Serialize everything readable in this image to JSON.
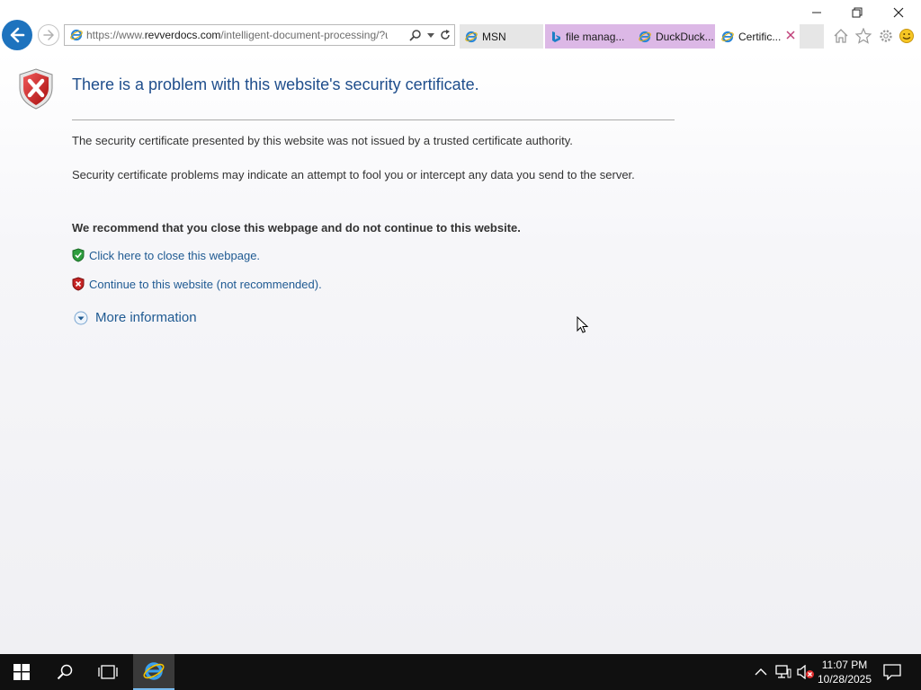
{
  "browser": {
    "url_prefix": "https://www.",
    "url_domain": "revverdocs.com",
    "url_path": "/intelligent-document-processing/?ut",
    "tabs": [
      {
        "label": "MSN"
      },
      {
        "label": "file manag..."
      },
      {
        "label": "DuckDuck..."
      },
      {
        "label": "Certific..."
      }
    ],
    "colors": {
      "accent": "#1e73be",
      "tab_highlight": "#dcb8e6"
    }
  },
  "page": {
    "title": "There is a problem with this website's security certificate.",
    "para1": "The security certificate presented by this website was not issued by a trusted certificate authority.",
    "para2": "Security certificate problems may indicate an attempt to fool you or intercept any data you send to the server.",
    "recommend": "We recommend that you close this webpage and do not continue to this website.",
    "close_link": "Click here to close this webpage.",
    "continue_link": "Continue to this website (not recommended).",
    "more_info": "More information"
  },
  "taskbar": {
    "time": "11:07 PM",
    "date": "10/28/2025"
  }
}
